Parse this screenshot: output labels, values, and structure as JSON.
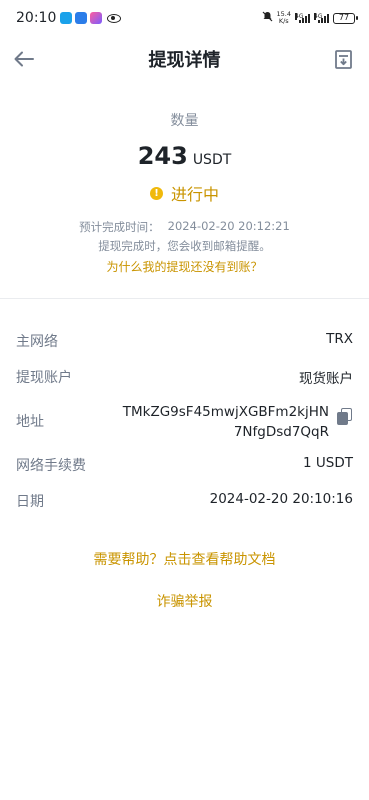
{
  "status_bar": {
    "time": "20:10",
    "net_speed_top": "15.4",
    "net_speed_bottom": "K/s",
    "signal_1_label": "4G",
    "signal_2_label": "4G",
    "battery": "77"
  },
  "header": {
    "title": "提现详情"
  },
  "summary": {
    "amount_label": "数量",
    "amount": "243",
    "unit": "USDT",
    "status": "进行中",
    "eta_label": "预计完成时间：",
    "eta_value": "2024-02-20 20:12:21",
    "notice": "提现完成时，您会收到邮箱提醒。",
    "why_link": "为什么我的提现还没有到账？"
  },
  "details": {
    "network": {
      "label": "主网络",
      "value": "TRX"
    },
    "account": {
      "label": "提现账户",
      "value": "现货账户"
    },
    "address": {
      "label": "地址",
      "line1": "TMkZG9sF45mwjXGBFm2kjHN",
      "line2": "7NfgDsd7QqR"
    },
    "fee": {
      "label": "网络手续费",
      "value": "1 USDT"
    },
    "date": {
      "label": "日期",
      "value": "2024-02-20 20:10:16"
    }
  },
  "links": {
    "help": "需要帮助？点击查看帮助文档",
    "fraud": "诈骗举报"
  },
  "colors": {
    "accent": "#c99400",
    "status_yellow": "#f0b90b",
    "text_primary": "#1e2329",
    "text_secondary": "#707a8a"
  }
}
